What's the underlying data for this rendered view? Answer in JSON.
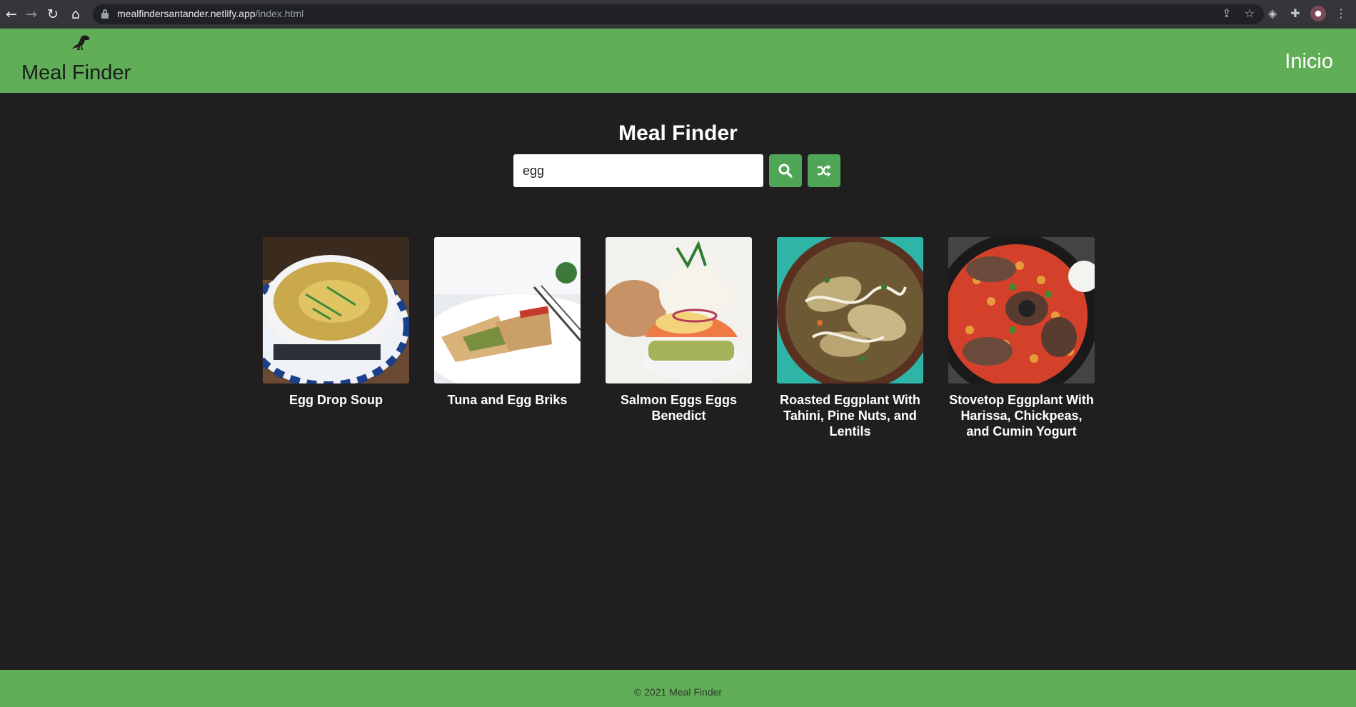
{
  "browser": {
    "url_host": "mealfindersantander.netlify.app",
    "url_path": "/index.html",
    "icons": [
      "back-icon",
      "forward-icon",
      "reload-icon",
      "home-icon",
      "lock-icon",
      "share-icon",
      "star-icon",
      "extension-icon",
      "puzzle-icon",
      "profile-avatar",
      "menu-icon"
    ]
  },
  "header": {
    "logo_text": "Meal Finder",
    "logo_icon": "dinosaur-icon",
    "nav_link": "Inicio"
  },
  "main": {
    "title": "Meal Finder",
    "search": {
      "value": "egg",
      "placeholder": "Search for meals or keywords"
    },
    "search_button_icon": "search-icon",
    "random_button_icon": "shuffle-icon"
  },
  "meals": [
    {
      "name": "Egg Drop Soup"
    },
    {
      "name": "Tuna and Egg Briks"
    },
    {
      "name": "Salmon Eggs Eggs Benedict"
    },
    {
      "name": "Roasted Eggplant With Tahini, Pine Nuts, and Lentils"
    },
    {
      "name": "Stovetop Eggplant With Harissa, Chickpeas, and Cumin Yogurt"
    }
  ],
  "footer": {
    "text": "© 2021 Meal Finder"
  },
  "colors": {
    "brand_green": "#61ae59",
    "button_green": "#4fa556",
    "background": "#201e1f"
  }
}
